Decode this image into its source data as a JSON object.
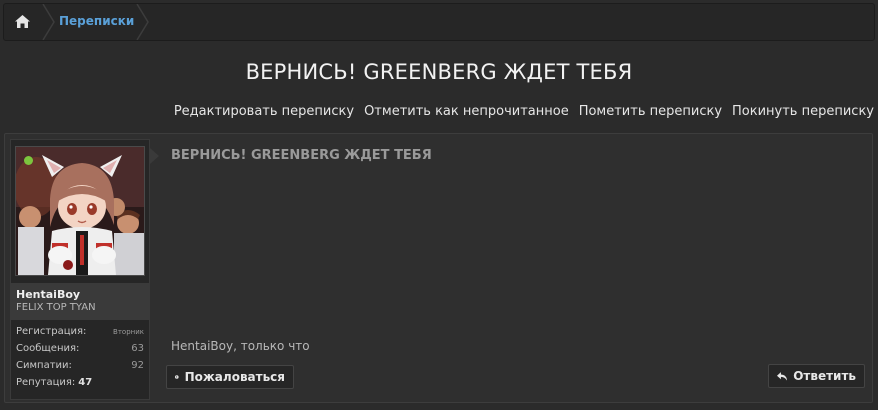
{
  "breadcrumb": {
    "home_icon": "home-icon",
    "items": [
      {
        "label": "Переписки"
      }
    ]
  },
  "title": "ВЕРНИСЬ! GREENBERG ЖДЕТ ТЕБЯ",
  "actions": [
    {
      "label": "Редактировать переписку"
    },
    {
      "label": "Отметить как непрочитанное"
    },
    {
      "label": "Пометить переписку"
    },
    {
      "label": "Покинуть переписку"
    }
  ],
  "message": {
    "title": "ВЕРНИСЬ! GREENBERG ЖДЕТ ТЕБЯ",
    "meta": "HentaiBoy, только что",
    "report_label": "Пожаловаться",
    "reply_label": "Ответить"
  },
  "user": {
    "name": "HentaiBoy",
    "title": "FELIX TOP TYAN",
    "online": true,
    "stats": {
      "registration_label": "Регистрация:",
      "registration_value": "Вторник",
      "messages_label": "Сообщения:",
      "messages_value": "63",
      "likes_label": "Симпатии:",
      "likes_value": "92",
      "reputation_label": "Репутация:",
      "reputation_value": "47"
    }
  },
  "colors": {
    "background": "#2b2b2b",
    "link": "#5aa0d8",
    "online": "#7cc63e"
  }
}
